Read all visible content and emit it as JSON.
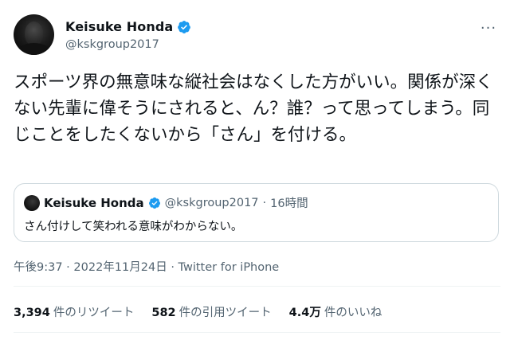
{
  "author": {
    "display_name": "Keisuke Honda",
    "handle": "@kskgroup2017",
    "verified": true,
    "accent_color": "#1d9bf0"
  },
  "more_icon": "more-horizontal-icon",
  "more_glyph": "···",
  "tweet": {
    "text": "スポーツ界の無意味な縦社会はなくした方がいい。関係が深くない先輩に偉そうにされると、ん？誰？って思ってしまう。同じことをしたくないから「さん」を付ける。"
  },
  "quoted_tweet": {
    "display_name": "Keisuke Honda",
    "handle": "@kskgroup2017",
    "separator": "·",
    "time_ago": "16時間",
    "text": "さん付けして笑われる意味がわからない。"
  },
  "meta": {
    "time": "午後9:37",
    "separator": "·",
    "date": "2022年11月24日",
    "source": "Twitter for iPhone"
  },
  "stats": [
    {
      "count": "3,394",
      "label": "件のリツイート"
    },
    {
      "count": "582",
      "label": "件の引用ツイート"
    },
    {
      "count": "4.4万",
      "label": "件のいいね"
    }
  ]
}
